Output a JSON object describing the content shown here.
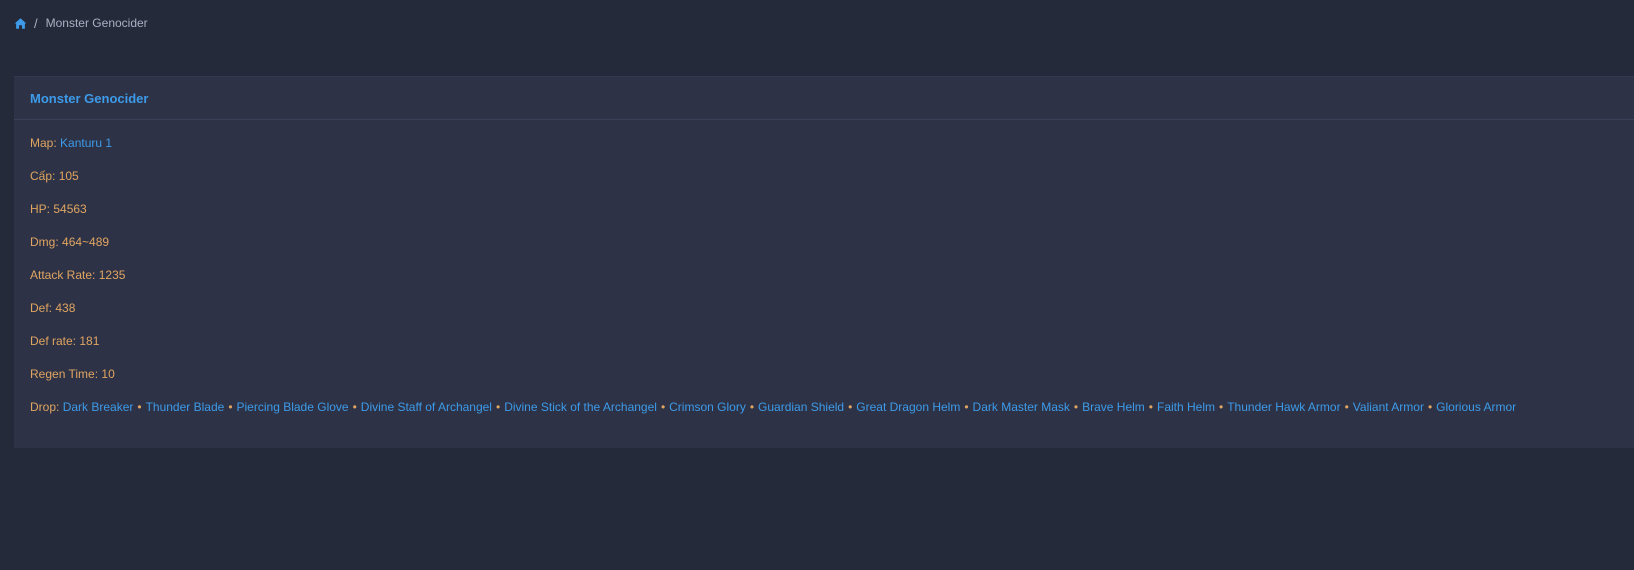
{
  "colors": {
    "background": "#252a3a",
    "card": "#2d3246",
    "accent": "#3d9be9",
    "label": "#e0a561"
  },
  "breadcrumb": {
    "home_icon": "home-icon",
    "separator": "/",
    "current": "Monster Genocider"
  },
  "card": {
    "title": "Monster Genocider",
    "map": {
      "label": "Map:",
      "value": "Kanturu 1"
    },
    "level": {
      "label": "Cấp:",
      "value": "105"
    },
    "hp": {
      "label": "HP:",
      "value": "54563"
    },
    "dmg": {
      "label": "Dmg:",
      "value": "464~489"
    },
    "attack_rate": {
      "label": "Attack Rate:",
      "value": "1235"
    },
    "def": {
      "label": "Def:",
      "value": "438"
    },
    "def_rate": {
      "label": "Def rate:",
      "value": "181"
    },
    "regen_time": {
      "label": "Regen Time:",
      "value": "10"
    },
    "drop": {
      "label": "Drop:",
      "separator": "•",
      "items": [
        "Dark Breaker",
        "Thunder Blade",
        "Piercing Blade Glove",
        "Divine Staff of Archangel",
        "Divine Stick of the Archangel",
        "Crimson Glory",
        "Guardian Shield",
        "Great Dragon Helm",
        "Dark Master Mask",
        "Brave Helm",
        "Faith Helm",
        "Thunder Hawk Armor",
        "Valiant Armor",
        "Glorious Armor"
      ]
    }
  }
}
